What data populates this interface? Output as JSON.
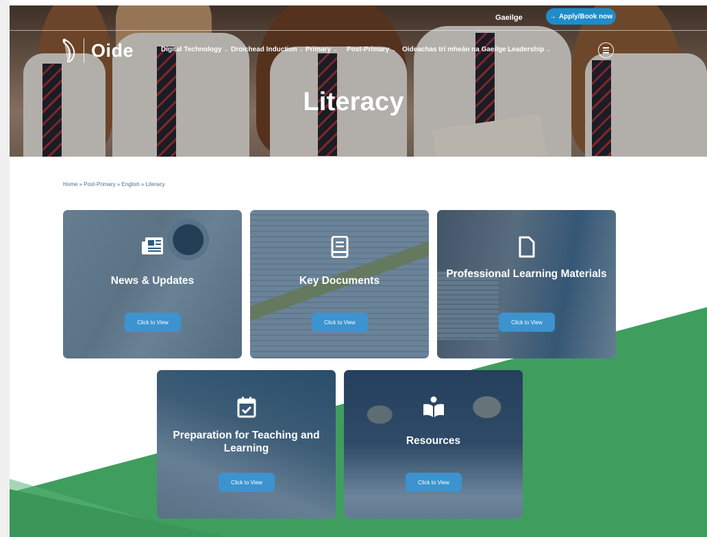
{
  "header": {
    "language_link": "Gaeilge",
    "apply_button": "Apply/Book now",
    "logo_text": "Oide",
    "nav": [
      {
        "label": "Digital Technology"
      },
      {
        "label": "Droichead Induction"
      },
      {
        "label": "Primary"
      },
      {
        "label": "Post-Primary"
      },
      {
        "label": "Oideachas trí mheán na Gaeilge"
      },
      {
        "label": "Leadership"
      }
    ],
    "menu_icon": "hamburger-menu-icon"
  },
  "hero": {
    "title": "Literacy"
  },
  "breadcrumb": [
    "Home",
    "Post-Primary",
    "English",
    "Literacy"
  ],
  "breadcrumb_separator": "»",
  "cards": [
    {
      "title": "News & Updates",
      "icon": "newspaper-icon",
      "button": "Click to View"
    },
    {
      "title": "Key Documents",
      "icon": "document-icon",
      "button": "Click to View"
    },
    {
      "title": "Professional Learning Materials",
      "icon": "file-icon",
      "button": "Click to View"
    },
    {
      "title": "Preparation for Teaching and Learning",
      "icon": "calendar-check-icon",
      "button": "Click to View"
    },
    {
      "title": "Resources",
      "icon": "reading-icon",
      "button": "Click to View"
    }
  ],
  "colors": {
    "primary_blue": "#1f8cc9",
    "card_overlay": "#1f4970",
    "button_blue": "#3c93cf",
    "green": "#3f9e5e",
    "breadcrumb_text": "#4f6f8c"
  }
}
